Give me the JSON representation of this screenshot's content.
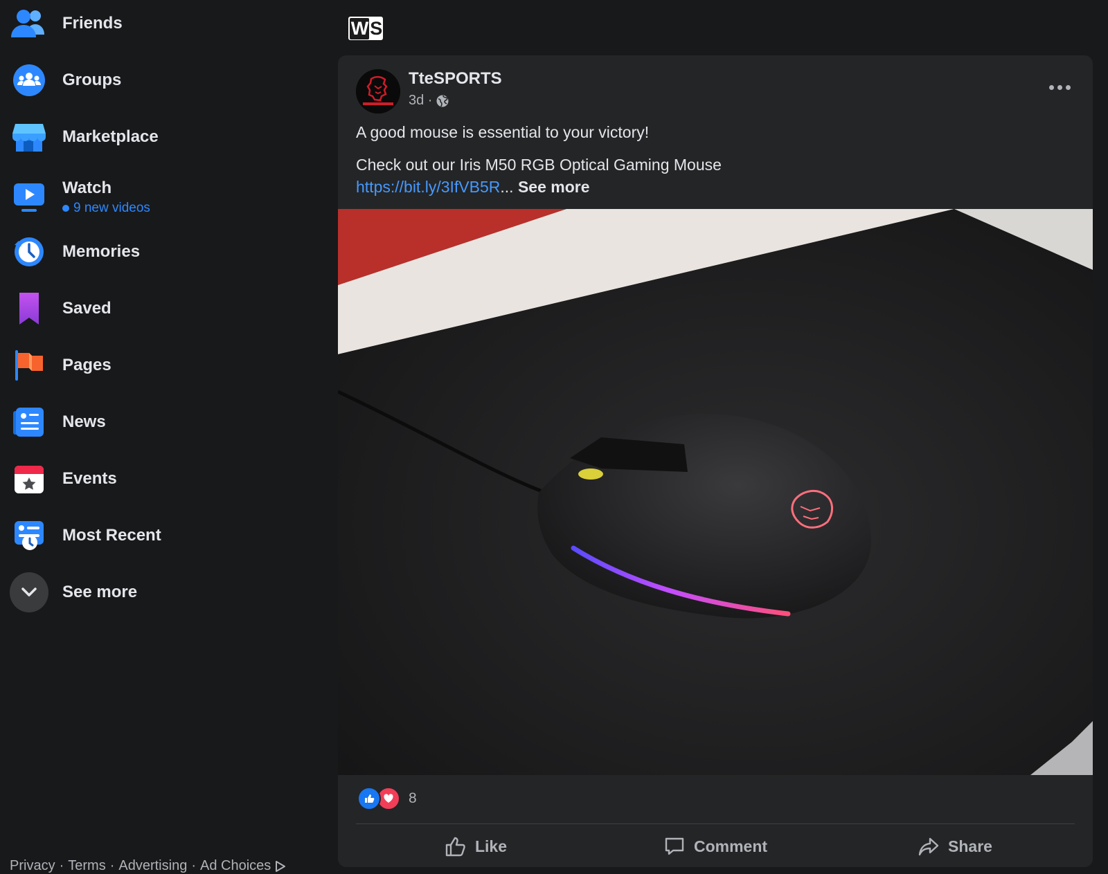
{
  "sidebar": {
    "items": [
      {
        "label": "Friends",
        "icon": "friends-icon"
      },
      {
        "label": "Groups",
        "icon": "groups-icon"
      },
      {
        "label": "Marketplace",
        "icon": "marketplace-icon"
      },
      {
        "label": "Watch",
        "icon": "watch-icon",
        "sub": "9 new videos"
      },
      {
        "label": "Memories",
        "icon": "memories-icon"
      },
      {
        "label": "Saved",
        "icon": "saved-icon"
      },
      {
        "label": "Pages",
        "icon": "pages-icon"
      },
      {
        "label": "News",
        "icon": "news-icon"
      },
      {
        "label": "Events",
        "icon": "events-icon"
      },
      {
        "label": "Most Recent",
        "icon": "most-recent-icon"
      },
      {
        "label": "See more",
        "icon": "chevron-down-icon"
      }
    ],
    "footer": [
      "Privacy",
      "Terms",
      "Advertising",
      "Ad Choices"
    ]
  },
  "feed": {
    "logo_text": {
      "w": "W",
      "s": "S"
    },
    "post": {
      "author": "TteSPORTS",
      "time": "3d ·",
      "line1": "A good mouse is essential to your victory!",
      "line2": "Check out our Iris M50 RGB Optical Gaming Mouse",
      "link": "https://bit.ly/3IfVB5R",
      "ellipsis": "...",
      "see_more": "See more",
      "reaction_count": "8",
      "actions": {
        "like": "Like",
        "comment": "Comment",
        "share": "Share"
      }
    }
  },
  "colors": {
    "background": "#18191a",
    "card": "#242526",
    "accent": "#2d88ff",
    "love": "#f33e58"
  }
}
